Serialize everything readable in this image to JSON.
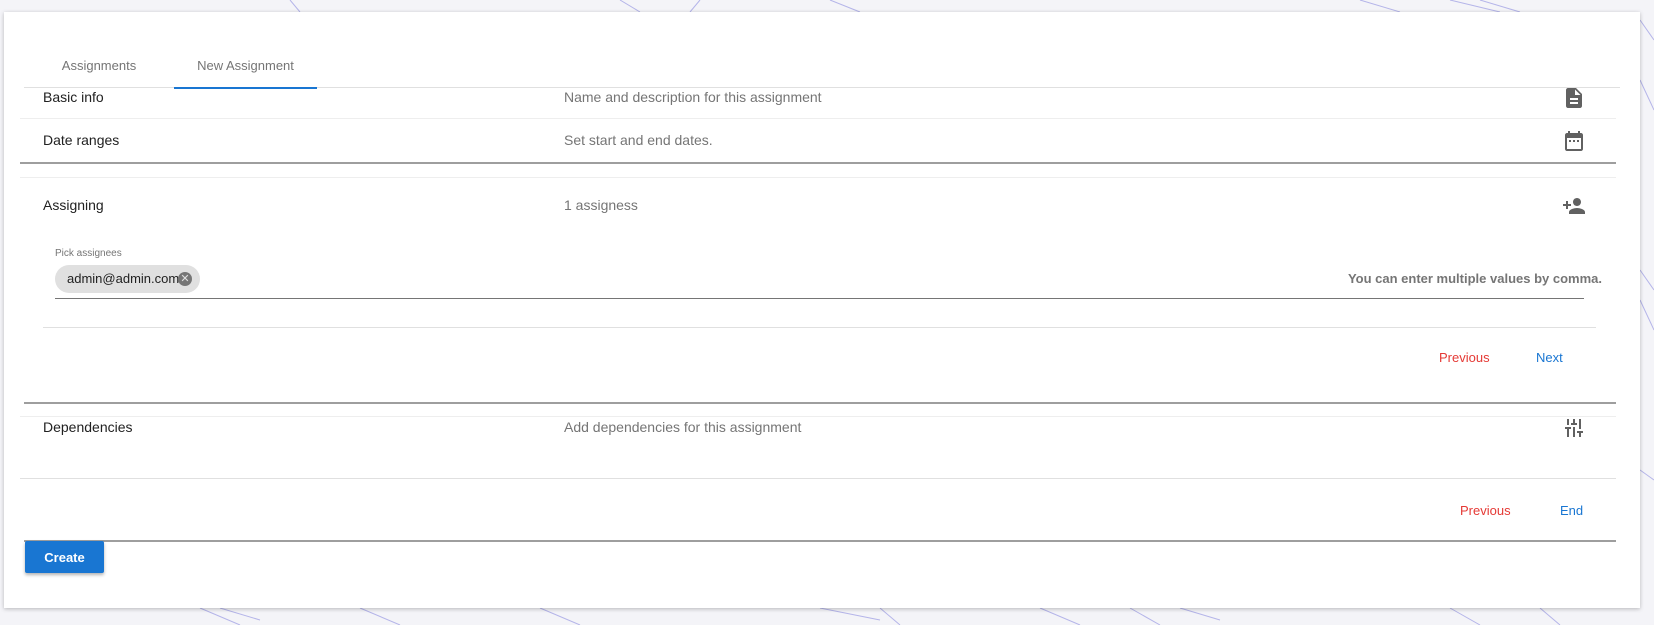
{
  "tabs": [
    {
      "label": "Assignments"
    },
    {
      "label": "New Assignment"
    }
  ],
  "steps": {
    "basic": {
      "title": "Basic info",
      "description": "Name and description for this assignment",
      "icon": "document-icon"
    },
    "dates": {
      "title": "Date ranges",
      "description": "Set start and end dates.",
      "icon": "calendar-icon"
    },
    "assigning": {
      "title": "Assigning",
      "description": "1 assigness",
      "icon": "add-person-icon"
    },
    "dependencies": {
      "title": "Dependencies",
      "description": "Add dependencies for this assignment",
      "icon": "sliders-icon"
    }
  },
  "assignees": {
    "label": "Pick assignees",
    "chips": [
      "admin@admin.com"
    ],
    "hint": "You can enter multiple values by comma."
  },
  "nav": {
    "previous": "Previous",
    "next": "Next",
    "end": "End"
  },
  "create_label": "Create",
  "colors": {
    "primary": "#1976d2",
    "danger": "#e53935",
    "muted": "#757575"
  }
}
